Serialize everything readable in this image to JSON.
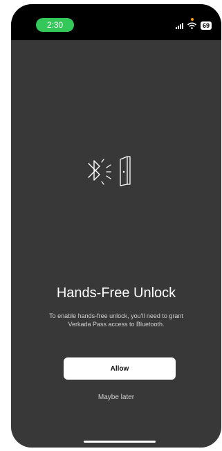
{
  "status_bar": {
    "time": "2:30",
    "battery": "69"
  },
  "onboarding": {
    "title": "Hands-Free Unlock",
    "description": "To enable hands-free unlock, you'll need to grant Verkada Pass access to Bluetooth.",
    "allow_label": "Allow",
    "maybe_later_label": "Maybe later",
    "hero_icons": [
      "bluetooth-icon",
      "signal-waves-icon",
      "door-icon"
    ]
  },
  "colors": {
    "time_pill": "#34c759",
    "screen_background": "#383838",
    "primary_button": "#ffffff"
  }
}
